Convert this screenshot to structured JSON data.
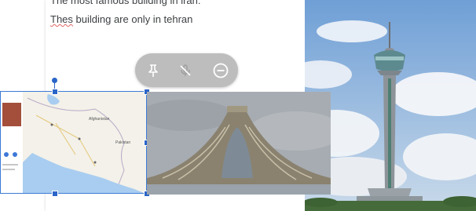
{
  "document": {
    "line1": "The most famous building in iran:",
    "line2_word": "Thes",
    "line2_rest": " building are only in tehran"
  },
  "toolbar": {
    "buttons": [
      {
        "icon": "pin-icon"
      },
      {
        "icon": "mic-off-icon"
      },
      {
        "icon": "remove-icon"
      }
    ]
  },
  "map": {
    "label_afghanistan": "Afghanistan",
    "label_pakistan": "Pakistan"
  },
  "colors": {
    "selection": "#3b7bd5",
    "toolbar_bg": "#bdbdbd"
  }
}
